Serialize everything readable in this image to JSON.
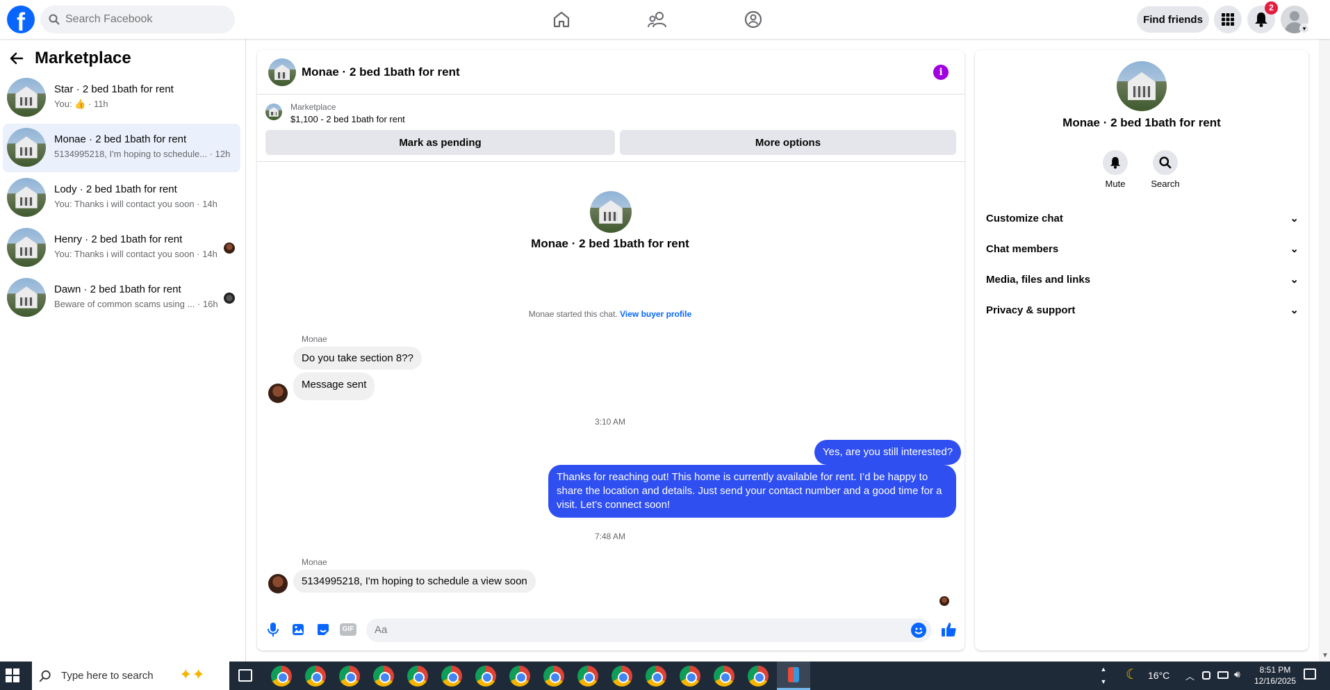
{
  "topbar": {
    "search_placeholder": "Search Facebook",
    "find_friends": "Find friends",
    "notif_count": "2"
  },
  "left": {
    "title": "Marketplace",
    "conversations": [
      {
        "title": "Star · 2 bed 1bath for rent",
        "sub": "You:",
        "time": "· 11h"
      },
      {
        "title": "Monae · 2 bed 1bath for rent",
        "sub": "5134995218, I'm hoping to schedule...",
        "time": "· 12h"
      },
      {
        "title": "Lody · 2 bed 1bath for rent",
        "sub": "You: Thanks i will contact you soon",
        "time": "· 14h"
      },
      {
        "title": "Henry · 2 bed 1bath for rent",
        "sub": "You: Thanks i will contact you soon",
        "time": "· 14h"
      },
      {
        "title": "Dawn · 2 bed 1bath for rent",
        "sub": "Beware of common scams using ...",
        "time": "· 16h"
      }
    ]
  },
  "chat": {
    "header_title": "Monae · 2 bed 1bath for rent",
    "listing_source": "Marketplace",
    "listing_detail": "$1,100 - 2 bed 1bath for rent",
    "mark_pending": "Mark as pending",
    "more_options": "More options",
    "center_title": "Monae · 2 bed 1bath for rent",
    "started_text": "Monae started this chat.",
    "view_profile": "View buyer profile",
    "sender1": "Monae",
    "msg1": "Do you take section 8??",
    "msg2": "Message sent",
    "time1": "3:10 AM",
    "out1": "Yes, are you still interested?",
    "out2": "Thanks for reaching out! This home is currently available for rent. I’d be happy to share the location and details. Just send your contact number and a good time for a visit. Let’s connect soon!",
    "time2": "7:48 AM",
    "sender2": "Monae",
    "msg3": "5134995218, I'm hoping to schedule a view soon",
    "composer_placeholder": "Aa"
  },
  "right": {
    "title": "Monae · 2 bed 1bath for rent",
    "mute": "Mute",
    "search": "Search",
    "sections": [
      "Customize chat",
      "Chat members",
      "Media, files and links",
      "Privacy & support"
    ]
  },
  "taskbar": {
    "search_placeholder": "Type here to search",
    "weather": "16°C",
    "time": "8:51 PM",
    "date": "12/16/2025"
  },
  "colors": {
    "brand": "#0866ff",
    "outgoing_bubble": "#2f4ff0",
    "info_icon": "#a100e0"
  }
}
